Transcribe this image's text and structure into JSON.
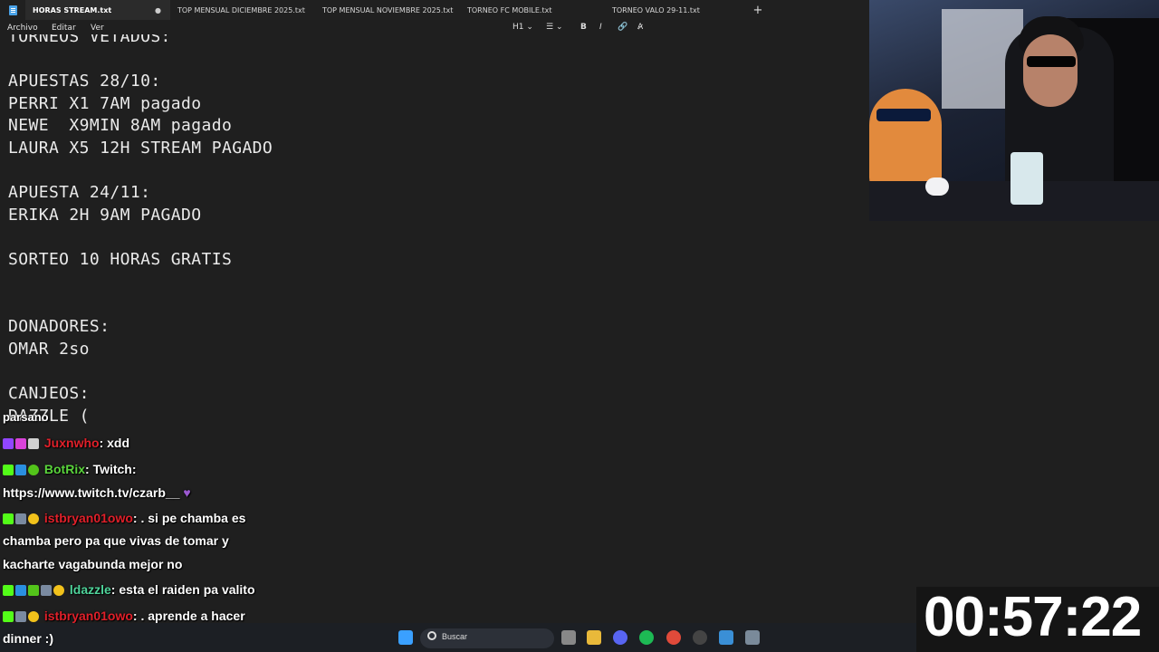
{
  "tabs": [
    {
      "label": "HORAS STREAM.txt",
      "active": true
    },
    {
      "label": "TOP MENSUAL DICIEMBRE 2025.txt",
      "active": false
    },
    {
      "label": "TOP MENSUAL NOVIEMBRE 2025.txt",
      "active": false
    },
    {
      "label": "TORNEO FC MOBILE.txt",
      "active": false
    },
    {
      "label": "TORNEO VALO 29-11.txt",
      "active": false
    }
  ],
  "tab_modified_dot": "●",
  "tab_add": "+",
  "menu": {
    "file": "Archivo",
    "edit": "Editar",
    "view": "Ver"
  },
  "format_toolbar": {
    "heading": "H1",
    "list": "☰",
    "bold": "B",
    "italic": "I",
    "link": "🔗",
    "clear": "A̷"
  },
  "editor_lines": [
    "TORNEOS VETADOS:",
    "APUESTAS 28/10:",
    "PERRI X1 7AM pagado",
    "NEWE  X9MIN 8AM pagado",
    "LAURA X5 12H STREAM PAGADO",
    "APUESTA 24/11:",
    "ERIKA 2H 9AM PAGADO",
    "SORTEO 10 HORAS GRATIS",
    "DONADORES:",
    "OMAR 2so",
    "CANJEOS:",
    "DAZZLE ("
  ],
  "chat": {
    "overflow_word": "parsano",
    "messages": [
      {
        "user": "Juxnwho",
        "user_color": "#e0202a",
        "text": ": xdd",
        "cont": ""
      },
      {
        "user": "BotRix",
        "user_color": "#5ad43c",
        "text": ": Twitch:",
        "cont": "https://www.twitch.tv/czarb__"
      },
      {
        "user": "istbryan01owo",
        "user_color": "#e0202a",
        "text": ": . si pe chamba es",
        "cont": "chamba pero pa que vivas de tomar y",
        "cont2": "kacharte vagabunda mejor no"
      },
      {
        "user": "ldazzle",
        "user_color": "#4fd39a",
        "text": ": esta el raiden pa valito",
        "cont": ""
      },
      {
        "user": "istbryan01owo",
        "user_color": "#e0202a",
        "text": ": . aprende a hacer",
        "cont": "dinner :)"
      }
    ]
  },
  "timer": "00:57:22",
  "taskbar": {
    "search_placeholder": "Buscar"
  }
}
